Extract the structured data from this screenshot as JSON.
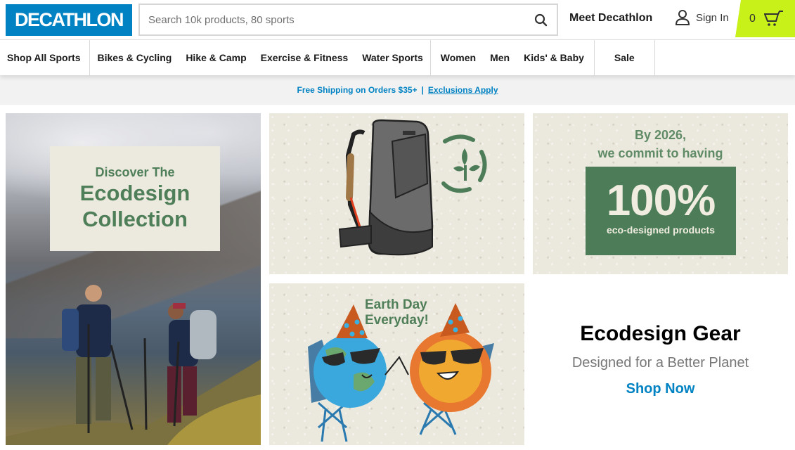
{
  "header": {
    "logo_text": "DECATHLON",
    "search_placeholder": "Search 10k products, 80 sports",
    "meet_label": "Meet Decathlon",
    "signin_label": "Sign In",
    "cart_count": "0"
  },
  "nav": {
    "groups": [
      [
        "Shop All Sports"
      ],
      [
        "Bikes & Cycling",
        "Hike & Camp",
        "Exercise & Fitness",
        "Water Sports"
      ],
      [
        "Women",
        "Men",
        "Kids' & Baby"
      ],
      [
        "Sale"
      ]
    ]
  },
  "banner": {
    "text": "Free Shipping on Orders $35+",
    "separator": "|",
    "link": "Exclusions Apply"
  },
  "tiles": {
    "collection": {
      "line1": "Discover The",
      "line2": "Ecodesign",
      "line3": "Collection"
    },
    "commit": {
      "line1": "By 2026,",
      "line2": "we commit to having",
      "percent": "100%",
      "sub": "eco-designed products"
    },
    "earthday": {
      "line1": "Earth Day",
      "line2": "Everyday!"
    }
  },
  "promo": {
    "title": "Ecodesign Gear",
    "subtitle": "Designed for a Better Planet",
    "cta": "Shop Now"
  },
  "colors": {
    "brand_blue": "#0082c3",
    "cart_green": "#c8f11a",
    "eco_green": "#4d7d58"
  }
}
